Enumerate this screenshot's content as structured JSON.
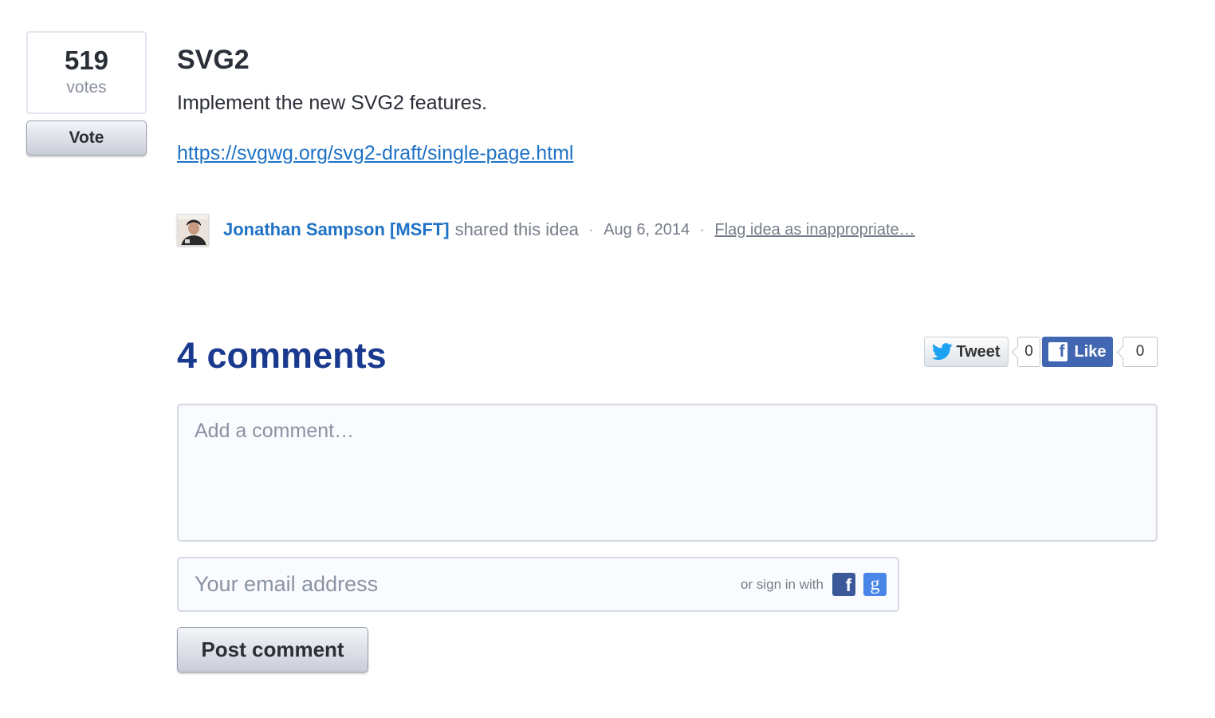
{
  "vote": {
    "count": "519",
    "label": "votes",
    "button_label": "Vote"
  },
  "idea": {
    "title": "SVG2",
    "description": "Implement the new SVG2 features.",
    "link": "https://svgwg.org/svg2-draft/single-page.html"
  },
  "meta": {
    "author": "Jonathan Sampson [MSFT]",
    "shared_text": "shared this idea",
    "separator": "·",
    "date": "Aug 6, 2014",
    "flag_link": "Flag idea as inappropriate…"
  },
  "comments": {
    "title": "4 comments",
    "comment_placeholder": "Add a comment…",
    "email_placeholder": "Your email address",
    "signin_text": "or sign in with",
    "post_button": "Post comment"
  },
  "share": {
    "tweet_label": "Tweet",
    "tweet_count": "0",
    "like_label": "Like",
    "like_count": "0"
  },
  "colors": {
    "link": "#1f72c5",
    "comments_title": "#1a3a8f",
    "facebook": "#4267b2",
    "google": "#4a86e8"
  },
  "icons": [
    "twitter-bird-icon",
    "facebook-f-icon",
    "facebook-signin-icon",
    "google-signin-icon"
  ]
}
